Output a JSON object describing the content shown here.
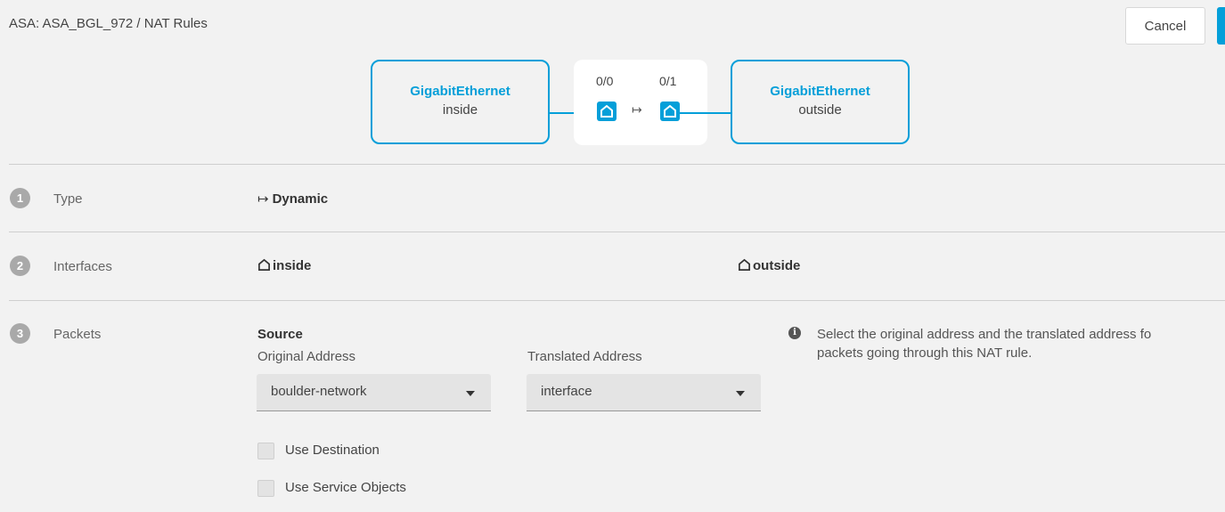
{
  "header": {
    "breadcrumb": "ASA: ASA_BGL_972 / NAT Rules",
    "cancel_label": "Cancel"
  },
  "diagram": {
    "inside": {
      "interface": "GigabitEthernet",
      "zone": "inside"
    },
    "outside": {
      "interface": "GigabitEthernet",
      "zone": "outside"
    },
    "ports": {
      "left": "0/0",
      "right": "0/1"
    },
    "mapping_arrow": "↦",
    "accent_color": "#049fd9"
  },
  "steps": [
    {
      "number": "1",
      "label": "Type",
      "value": "Dynamic",
      "value_icon": "↦"
    },
    {
      "number": "2",
      "label": "Interfaces",
      "source_interface": "inside",
      "destination_interface": "outside",
      "interface_icon": "interface-icon"
    },
    {
      "number": "3",
      "label": "Packets"
    }
  ],
  "packets": {
    "section_title": "Source",
    "original_address_label": "Original Address",
    "translated_address_label": "Translated Address",
    "original_address_value": "boulder-network",
    "translated_address_value": "interface",
    "use_destination_label": "Use Destination",
    "use_service_objects_label": "Use Service Objects",
    "use_destination_checked": false,
    "use_service_objects_checked": false,
    "info_line1": "Select the original address and the translated address fo",
    "info_line2": "packets going through this NAT rule."
  }
}
